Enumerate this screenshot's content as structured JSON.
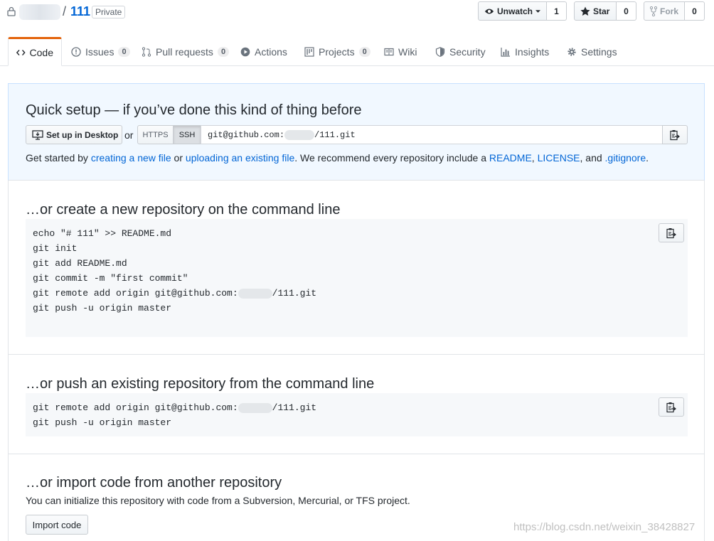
{
  "header": {
    "owner": "",
    "separator": "/",
    "repo": "111",
    "visibility": "Private",
    "unwatch_label": "Unwatch",
    "watch_count": "1",
    "star_label": "Star",
    "star_count": "0",
    "fork_label": "Fork",
    "fork_count": "0"
  },
  "tabs": [
    {
      "label": "Code",
      "icon": "code-icon"
    },
    {
      "label": "Issues",
      "count": "0",
      "icon": "issue-icon"
    },
    {
      "label": "Pull requests",
      "count": "0",
      "icon": "pull-request-icon"
    },
    {
      "label": "Actions",
      "icon": "play-icon"
    },
    {
      "label": "Projects",
      "count": "0",
      "icon": "project-icon"
    },
    {
      "label": "Wiki",
      "icon": "book-icon"
    },
    {
      "label": "Security",
      "icon": "shield-icon"
    },
    {
      "label": "Insights",
      "icon": "graph-icon"
    },
    {
      "label": "Settings",
      "icon": "gear-icon"
    }
  ],
  "quick_setup": {
    "title": "Quick setup — if you’ve done this kind of thing before",
    "desktop_button": "Set up in Desktop",
    "or": "or",
    "https_label": "HTTPS",
    "ssh_label": "SSH",
    "url_prefix": "git@github.com:",
    "url_suffix": "/111.git",
    "help_1": "Get started by ",
    "link_new_file": "creating a new file",
    "help_2": " or ",
    "link_upload": "uploading an existing file",
    "help_3": ". We recommend every repository include a ",
    "link_readme": "README",
    "sep_comma": ",",
    "link_license": "LICENSE",
    "help_4": ", and ",
    "link_gitignore": ".gitignore",
    "help_5": "."
  },
  "new_repo": {
    "title": "…or create a new repository on the command line",
    "lines": [
      "echo \"# 111\" >> README.md",
      "git init",
      "git add README.md",
      "git commit -m \"first commit\"",
      "git remote add origin git@github.com:",
      "git push -u origin master"
    ],
    "remote_suffix": "/111.git"
  },
  "push_existing": {
    "title": "…or push an existing repository from the command line",
    "line1_prefix": "git remote add origin git@github.com:",
    "line1_suffix": "/111.git",
    "line2": "git push -u origin master"
  },
  "import": {
    "title": "…or import code from another repository",
    "description": "You can initialize this repository with code from a Subversion, Mercurial, or TFS project.",
    "button": "Import code"
  },
  "watermark": "https://blog.csdn.net/weixin_38428827",
  "colors": {
    "link": "#0366d6",
    "tab_accent": "#e36209",
    "setup_bg": "#f1f8ff"
  }
}
